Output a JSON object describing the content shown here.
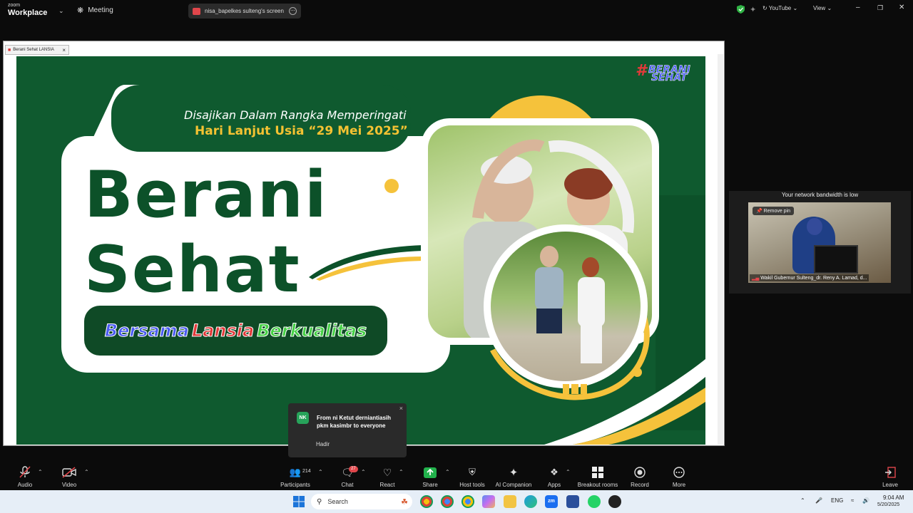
{
  "app": {
    "logo_line1": "zoom",
    "logo_line2": "Workplace",
    "meeting_label": "Meeting",
    "share_title": "nisa_bapelkes sulteng's screen",
    "youtube_label": "YouTube",
    "view_label": "View"
  },
  "shared_window": {
    "tab_title": "Berani Sehat LANSIA"
  },
  "slide": {
    "subtitle_line1": "Disajikan Dalam Rangka  Memperingati",
    "subtitle_line2": "Hari Lanjut Usia “29 Mei 2025”",
    "title_line1": "Berani",
    "title_line2": "Sehat",
    "tagline_word1": "Bersama",
    "tagline_word2": "Lansia",
    "tagline_word3": "Berkualitas",
    "logo_hash": "#",
    "logo_word1": "BERANI",
    "logo_word2": "SEHAT",
    "colors": {
      "green": "#0f5a2f",
      "yellow": "#f5c23b"
    }
  },
  "video_panel": {
    "bandwidth_notice": "Your network bandwidth is low",
    "remove_pin_label": "Remove pin",
    "participant_name": "Wakil Gubernur Sulteng_dr. Reny A. Lamad, d..."
  },
  "chat_toast": {
    "avatar_initials": "NK",
    "from_text": "From ni Ketut derniantiasih pkm kasimbr to everyone",
    "message": "Hadir"
  },
  "toolbar": {
    "audio": "Audio",
    "video": "Video",
    "participants": "Participants",
    "participants_count": "214",
    "chat": "Chat",
    "chat_badge": "27",
    "react": "React",
    "share": "Share",
    "host_tools": "Host tools",
    "ai_companion": "AI Companion",
    "apps": "Apps",
    "breakout_rooms": "Breakout rooms",
    "record": "Record",
    "more": "More",
    "leave": "Leave"
  },
  "taskbar": {
    "search_placeholder": "Search",
    "lang": "ENG",
    "time": "9:04 AM",
    "date": "5/20/2025"
  }
}
